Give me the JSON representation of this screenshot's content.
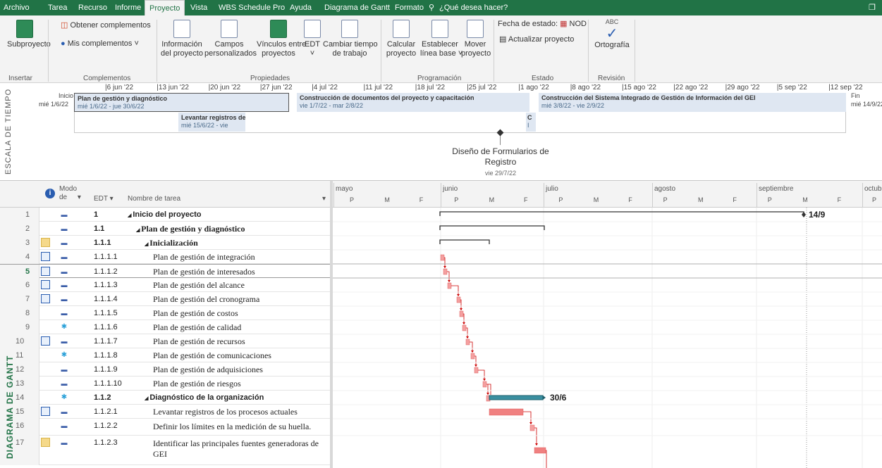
{
  "tabs": [
    "Archivo",
    "Tarea",
    "Recurso",
    "Informe",
    "Proyecto",
    "Vista",
    "WBS Schedule Pro",
    "Ayuda",
    "Diagrama de Gantt",
    "Formato"
  ],
  "active_tab": "Proyecto",
  "search_text": "¿Qué desea hacer?",
  "ribbon": {
    "subproyecto": "Subproyecto",
    "insertar": "Insertar",
    "obtener": "Obtener complementos",
    "mis": "Mis complementos",
    "complementos": "Complementos",
    "info1": "Información",
    "info2": "del proyecto",
    "campos1": "Campos",
    "campos2": "personalizados",
    "vinc1": "Vínculos entre",
    "vinc2": "proyectos",
    "edt": "EDT",
    "cambiar1": "Cambiar tiempo",
    "cambiar2": "de trabajo",
    "propiedades": "Propiedades",
    "calc1": "Calcular",
    "calc2": "proyecto",
    "estab1": "Establecer",
    "estab2": "línea base",
    "mover1": "Mover",
    "mover2": "proyecto",
    "programacion": "Programación",
    "fecha_estado": "Fecha de estado:",
    "nod": "NOD",
    "actualizar": "Actualizar proyecto",
    "estado": "Estado",
    "abc": "ABC",
    "ortografia": "Ortografía",
    "revision": "Revisión"
  },
  "timeline": {
    "side_label": "ESCALA DE TIEMPO",
    "dates": [
      "6 jun '22",
      "13 jun '22",
      "20 jun '22",
      "27 jun '22",
      "4 jul '22",
      "11 jul '22",
      "18 jul '22",
      "25 jul '22",
      "1 ago '22",
      "8 ago '22",
      "15 ago '22",
      "22 ago '22",
      "29 ago '22",
      "5 sep '22",
      "12 sep '22"
    ],
    "inicio": "Inicio",
    "inicio_date": "mié 1/6/22",
    "fin": "Fin",
    "fin_date": "mié 14/9/22",
    "bars": [
      {
        "title": "Plan de gestión y diagnóstico",
        "dates": "mié 1/6/22 - jue 30/6/22"
      },
      {
        "title": "Construcción de documentos del proyecto y capacitación",
        "dates": "vie 1/7/22 - mar 2/8/22"
      },
      {
        "title": "Construcción del Sistema Integrado de Gestión de Información del GEI",
        "dates": "mié 3/8/22 - vie 2/9/22"
      },
      {
        "title": "Levantar registros de",
        "dates": "mié 15/6/22 - vie"
      },
      {
        "title": "C",
        "dates": "I"
      }
    ],
    "milestone_title1": "Diseño de Formularios de",
    "milestone_title2": "Registro",
    "milestone_date": "vie 29/7/22"
  },
  "grid": {
    "side_label": "DIAGRAMA DE GANTT",
    "modo1": "Modo",
    "modo2": "de",
    "edt": "EDT",
    "nombre": "Nombre de tarea",
    "rows": [
      {
        "n": "1",
        "edt": "1",
        "name": "Inicio del proyecto"
      },
      {
        "n": "2",
        "edt": "1.1",
        "name": "Plan de gestión y diagnóstico"
      },
      {
        "n": "3",
        "edt": "1.1.1",
        "name": "Inicialización"
      },
      {
        "n": "4",
        "edt": "1.1.1.1",
        "name": "Plan de gestión de integración"
      },
      {
        "n": "5",
        "edt": "1.1.1.2",
        "name": "Plan de gestión de interesados"
      },
      {
        "n": "6",
        "edt": "1.1.1.3",
        "name": "Plan de gestión del alcance"
      },
      {
        "n": "7",
        "edt": "1.1.1.4",
        "name": "Plan de gestión del cronograma"
      },
      {
        "n": "8",
        "edt": "1.1.1.5",
        "name": "Plan de gestión de costos"
      },
      {
        "n": "9",
        "edt": "1.1.1.6",
        "name": "Plan de gestión de calidad"
      },
      {
        "n": "10",
        "edt": "1.1.1.7",
        "name": "Plan de gestión de recursos"
      },
      {
        "n": "11",
        "edt": "1.1.1.8",
        "name": "Plan de gestión de comunicaciones"
      },
      {
        "n": "12",
        "edt": "1.1.1.9",
        "name": "Plan de gestión de adquisiciones"
      },
      {
        "n": "13",
        "edt": "1.1.1.10",
        "name": "Plan de gestión de riesgos"
      },
      {
        "n": "14",
        "edt": "1.1.2",
        "name": "Diagnóstico de la organización"
      },
      {
        "n": "15",
        "edt": "1.1.2.1",
        "name": "Levantar registros de los procesos actuales"
      },
      {
        "n": "16",
        "edt": "1.1.2.2",
        "name": "Definir los límites  en la medición de su huella."
      },
      {
        "n": "17",
        "edt": "1.1.2.3",
        "name": "Identificar las principales fuentes generadoras de",
        "name2": "GEI"
      }
    ]
  },
  "gantt": {
    "months": [
      "mayo",
      "junio",
      "julio",
      "agosto",
      "septiembre",
      "octubre"
    ],
    "days": [
      "P",
      "M",
      "F",
      "P",
      "M",
      "F",
      "P",
      "M",
      "F",
      "P",
      "M",
      "F",
      "P",
      "M",
      "F",
      "P"
    ],
    "label_end": "14/9",
    "label_diag": "30/6"
  }
}
